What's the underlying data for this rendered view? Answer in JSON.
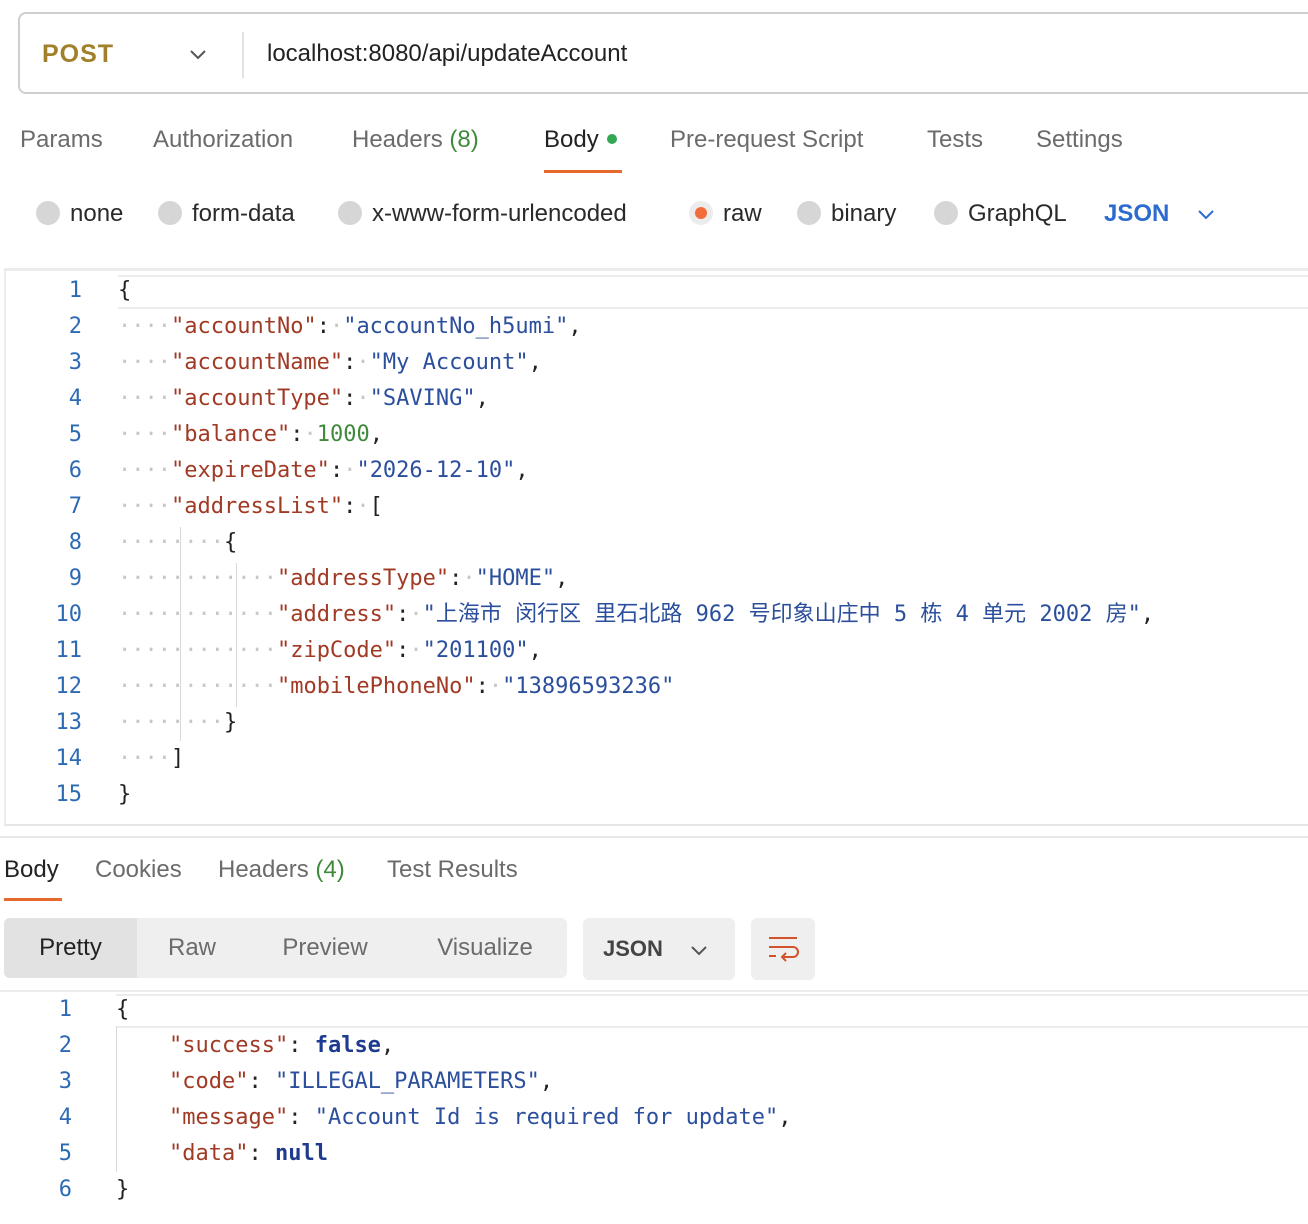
{
  "request": {
    "method": "POST",
    "url": "localhost:8080/api/updateAccount"
  },
  "request_tabs": [
    {
      "label": "Params"
    },
    {
      "label": "Authorization"
    },
    {
      "label": "Headers",
      "count": "(8)"
    },
    {
      "label": "Body"
    },
    {
      "label": "Pre-request Script"
    },
    {
      "label": "Tests"
    },
    {
      "label": "Settings"
    }
  ],
  "body_types": [
    {
      "label": "none",
      "selected": false
    },
    {
      "label": "form-data",
      "selected": false
    },
    {
      "label": "x-www-form-urlencoded",
      "selected": false
    },
    {
      "label": "raw",
      "selected": true
    },
    {
      "label": "binary",
      "selected": false
    },
    {
      "label": "GraphQL",
      "selected": false
    }
  ],
  "body_format": "JSON",
  "request_body": {
    "line_numbers": [
      "1",
      "2",
      "3",
      "4",
      "5",
      "6",
      "7",
      "8",
      "9",
      "10",
      "11",
      "12",
      "13",
      "14",
      "15"
    ],
    "accountNo": "accountNo_h5umi",
    "accountName": "My Account",
    "accountType": "SAVING",
    "balance": "1000",
    "expireDate": "2026-12-10",
    "addressType": "HOME",
    "address": "上海市 闵行区 里石北路 962 号印象山庄中 5 栋 4 单元 2002 房",
    "zipCode": "201100",
    "mobilePhoneNo": "13896593236"
  },
  "response_tabs": [
    {
      "label": "Body"
    },
    {
      "label": "Cookies"
    },
    {
      "label": "Headers",
      "count": "(4)"
    },
    {
      "label": "Test Results"
    }
  ],
  "view_modes": [
    "Pretty",
    "Raw",
    "Preview",
    "Visualize"
  ],
  "response_format": "JSON",
  "response_body": {
    "line_numbers": [
      "1",
      "2",
      "3",
      "4",
      "5",
      "6"
    ],
    "success": "false",
    "code": "ILLEGAL_PARAMETERS",
    "message": "Account Id is required for update",
    "data": "null"
  }
}
